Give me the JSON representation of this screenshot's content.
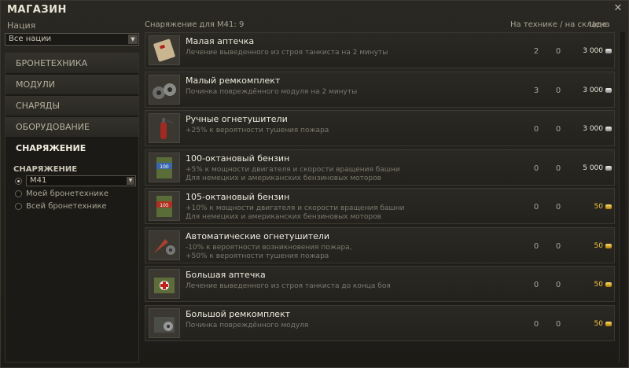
{
  "window": {
    "title": "МАГАЗИН"
  },
  "nation": {
    "label": "Нация",
    "selected": "Все нации"
  },
  "categories": [
    {
      "label": "БРОНЕТЕХНИКА",
      "active": false
    },
    {
      "label": "МОДУЛИ",
      "active": false
    },
    {
      "label": "СНАРЯДЫ",
      "active": false
    },
    {
      "label": "ОБОРУДОВАНИЕ",
      "active": false
    },
    {
      "label": "СНАРЯЖЕНИЕ",
      "active": true
    }
  ],
  "filter": {
    "title": "СНАРЯЖЕНИЕ",
    "vehicle_option": "M41",
    "option_my": "Моей бронетехнике",
    "option_all": "Всей бронетехнике",
    "selected": "vehicle"
  },
  "list_header": {
    "title": "Снаряжение для M41: 9",
    "count_label": "На технике / на складе",
    "price_label": "Цена"
  },
  "items": [
    {
      "name": "Малая аптечка",
      "desc": "Лечение выведенного из строя танкиста на 2 минуты",
      "desc2": "",
      "on_vehicle": "2",
      "in_stock": "0",
      "price": "3 000",
      "currency": "silver",
      "icon": "small-medkit-icon"
    },
    {
      "name": "Малый ремкомплект",
      "desc": "Починка повреждённого модуля на 2 минуты",
      "desc2": "",
      "on_vehicle": "3",
      "in_stock": "0",
      "price": "3 000",
      "currency": "silver",
      "icon": "small-repair-kit-icon"
    },
    {
      "name": "Ручные огнетушители",
      "desc": "+25% к вероятности тушения пожара",
      "desc2": "",
      "on_vehicle": "0",
      "in_stock": "0",
      "price": "3 000",
      "currency": "silver",
      "icon": "manual-extinguisher-icon"
    },
    {
      "name": "100-октановый бензин",
      "desc": "+5% к мощности двигателя и скорости вращения башни",
      "desc2": "Для немецких и американских бензиновых моторов",
      "on_vehicle": "0",
      "in_stock": "0",
      "price": "5 000",
      "currency": "silver",
      "icon": "fuel-100-icon"
    },
    {
      "name": "105-октановый бензин",
      "desc": "+10% к мощности двигателя и скорости вращения башни",
      "desc2": "Для немецких и американских бензиновых моторов",
      "on_vehicle": "0",
      "in_stock": "0",
      "price": "50",
      "currency": "gold",
      "icon": "fuel-105-icon"
    },
    {
      "name": "Автоматические огнетушители",
      "desc": "-10% к вероятности возникновения пожара,",
      "desc2": "+50% к вероятности тушения пожара",
      "on_vehicle": "0",
      "in_stock": "0",
      "price": "50",
      "currency": "gold",
      "icon": "auto-extinguisher-icon"
    },
    {
      "name": "Большая аптечка",
      "desc": "Лечение выведенного из строя танкиста до конца боя",
      "desc2": "",
      "on_vehicle": "0",
      "in_stock": "0",
      "price": "50",
      "currency": "gold",
      "icon": "large-medkit-icon"
    },
    {
      "name": "Большой ремкомплект",
      "desc": "Починка повреждённого модуля",
      "desc2": "",
      "on_vehicle": "0",
      "in_stock": "0",
      "price": "50",
      "currency": "gold",
      "icon": "large-repair-kit-icon"
    }
  ]
}
